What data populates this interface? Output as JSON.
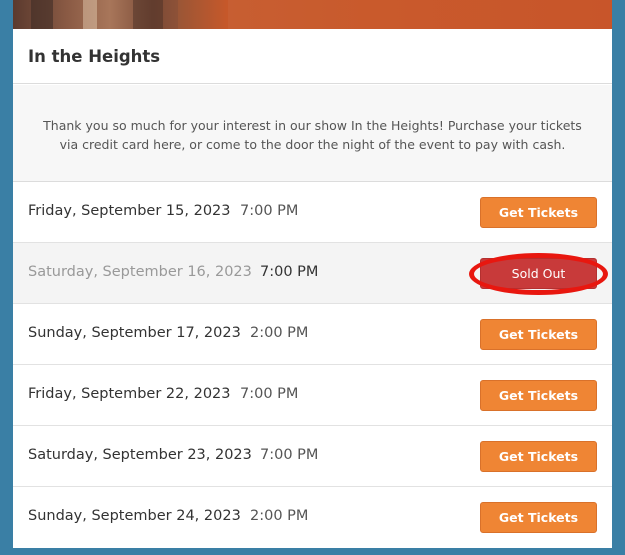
{
  "show": {
    "title": "In the Heights",
    "description": "Thank you so much for your interest in our show In the Heights! Purchase your tickets via credit card here, or come to the door the night of the event to pay with cash."
  },
  "performances": [
    {
      "date": "Friday, September 15, 2023",
      "time": "7:00 PM",
      "button": "Get Tickets",
      "sold_out": false
    },
    {
      "date": "Saturday, September 16, 2023",
      "time": "7:00 PM",
      "button": "Sold Out",
      "sold_out": true
    },
    {
      "date": "Sunday, September 17, 2023",
      "time": "2:00 PM",
      "button": "Get Tickets",
      "sold_out": false
    },
    {
      "date": "Friday, September 22, 2023",
      "time": "7:00 PM",
      "button": "Get Tickets",
      "sold_out": false
    },
    {
      "date": "Saturday, September 23, 2023",
      "time": "7:00 PM",
      "button": "Get Tickets",
      "sold_out": false
    },
    {
      "date": "Sunday, September 24, 2023",
      "time": "2:00 PM",
      "button": "Get Tickets",
      "sold_out": false
    }
  ],
  "colors": {
    "page_background": "#3a7fa5",
    "button_orange": "#ef8534",
    "sold_out_red": "#c83a3a",
    "highlight_red": "#e8170f"
  }
}
